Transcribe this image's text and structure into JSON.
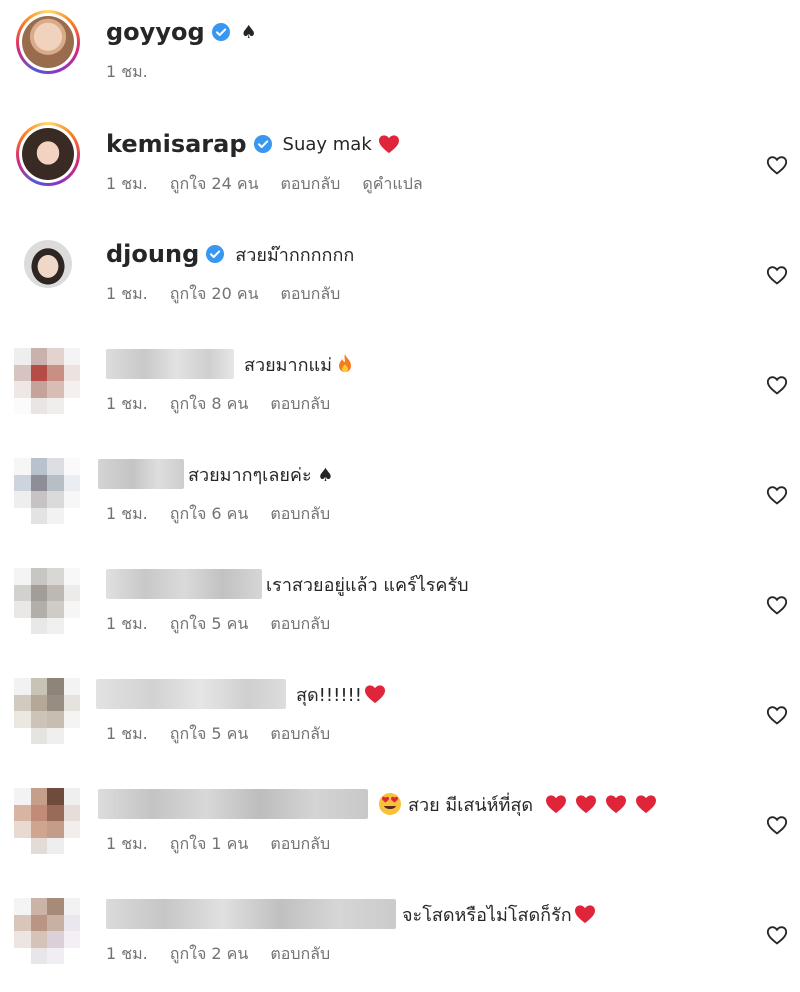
{
  "colors": {
    "verified": "#3897f0",
    "heart": "#ed4956",
    "meta": "#737373"
  },
  "comments": [
    {
      "username": "goyyog",
      "verified": true,
      "text": "♠",
      "time": "1 ชม.",
      "likes": "",
      "reply": "",
      "translate": ""
    },
    {
      "username": "kemisarap",
      "verified": true,
      "text": "Suay mak",
      "time": "1 ชม.",
      "likes": "ถูกใจ 24 คน",
      "reply": "ตอบกลับ",
      "translate": "ดูคำแปล"
    },
    {
      "username": "djoung",
      "verified": true,
      "text": "สวยม๊ากกกกกก",
      "time": "1 ชม.",
      "likes": "ถูกใจ 20 คน",
      "reply": "ตอบกลับ",
      "translate": ""
    },
    {
      "username": "",
      "verified": false,
      "text": "สวยมากแม่",
      "time": "1 ชม.",
      "likes": "ถูกใจ 8 คน",
      "reply": "ตอบกลับ",
      "translate": ""
    },
    {
      "username": "",
      "verified": false,
      "text": "สวยมากๆเลยค่ะ ♠",
      "time": "1 ชม.",
      "likes": "ถูกใจ 6 คน",
      "reply": "ตอบกลับ",
      "translate": ""
    },
    {
      "username": "",
      "verified": false,
      "text": "เราสวยอยู่แล้ว แคร์ไรครับ",
      "time": "1 ชม.",
      "likes": "ถูกใจ 5 คน",
      "reply": "ตอบกลับ",
      "translate": ""
    },
    {
      "username": "",
      "verified": false,
      "text": "สุด!!!!!!",
      "time": "1 ชม.",
      "likes": "ถูกใจ 5 คน",
      "reply": "ตอบกลับ",
      "translate": ""
    },
    {
      "username": "",
      "verified": false,
      "text": "สวย มีเสน่ห์ที่สุด",
      "time": "1 ชม.",
      "likes": "ถูกใจ 1 คน",
      "reply": "ตอบกลับ",
      "translate": ""
    },
    {
      "username": "",
      "verified": false,
      "text": "จะโสดหรือไม่โสดก็รัก",
      "time": "1 ชม.",
      "likes": "ถูกใจ 2 คน",
      "reply": "ตอบกลับ",
      "translate": ""
    }
  ]
}
